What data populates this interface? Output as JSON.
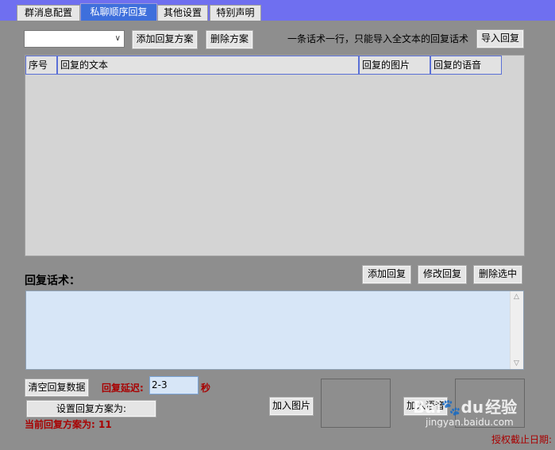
{
  "tabs": [
    "群消息配置",
    "私聊顺序回复",
    "其他设置",
    "特别声明"
  ],
  "active_tab": "私聊顺序回复",
  "toolbar": {
    "scheme_select_value": "",
    "add_scheme": "添加回复方案",
    "delete_scheme": "删除方案",
    "import_hint": "一条话术一行，只能导入全文本的回复话术",
    "import_reply": "导入回复"
  },
  "table": {
    "columns": [
      "序号",
      "回复的文本",
      "回复的图片",
      "回复的语音"
    ],
    "rows": []
  },
  "reply_section": {
    "label": "回复话术：",
    "add_reply": "添加回复",
    "edit_reply": "修改回复",
    "delete_selected": "删除选中",
    "text_value": ""
  },
  "bottom": {
    "clear_data": "清空回复数据",
    "delay_label": "回复延迟:",
    "delay_value": "2-3",
    "delay_unit": "秒",
    "set_scheme": "设置回复方案为:",
    "current_scheme": "当前回复方案为: 11",
    "add_image": "加入图片",
    "add_voice": "加入语音",
    "license_expiry": "授权截止日期:"
  },
  "watermark": {
    "site": "jingyan.baidu.com",
    "brand": "Bai",
    "brand2": "du",
    "product": "经验"
  },
  "colors": {
    "tab_bar": "#6f6ff0",
    "active_tab": "#3e6fdc",
    "panel": "#8e8e8e",
    "textarea": "#d7e6f7",
    "alert_red": "#a80000"
  }
}
